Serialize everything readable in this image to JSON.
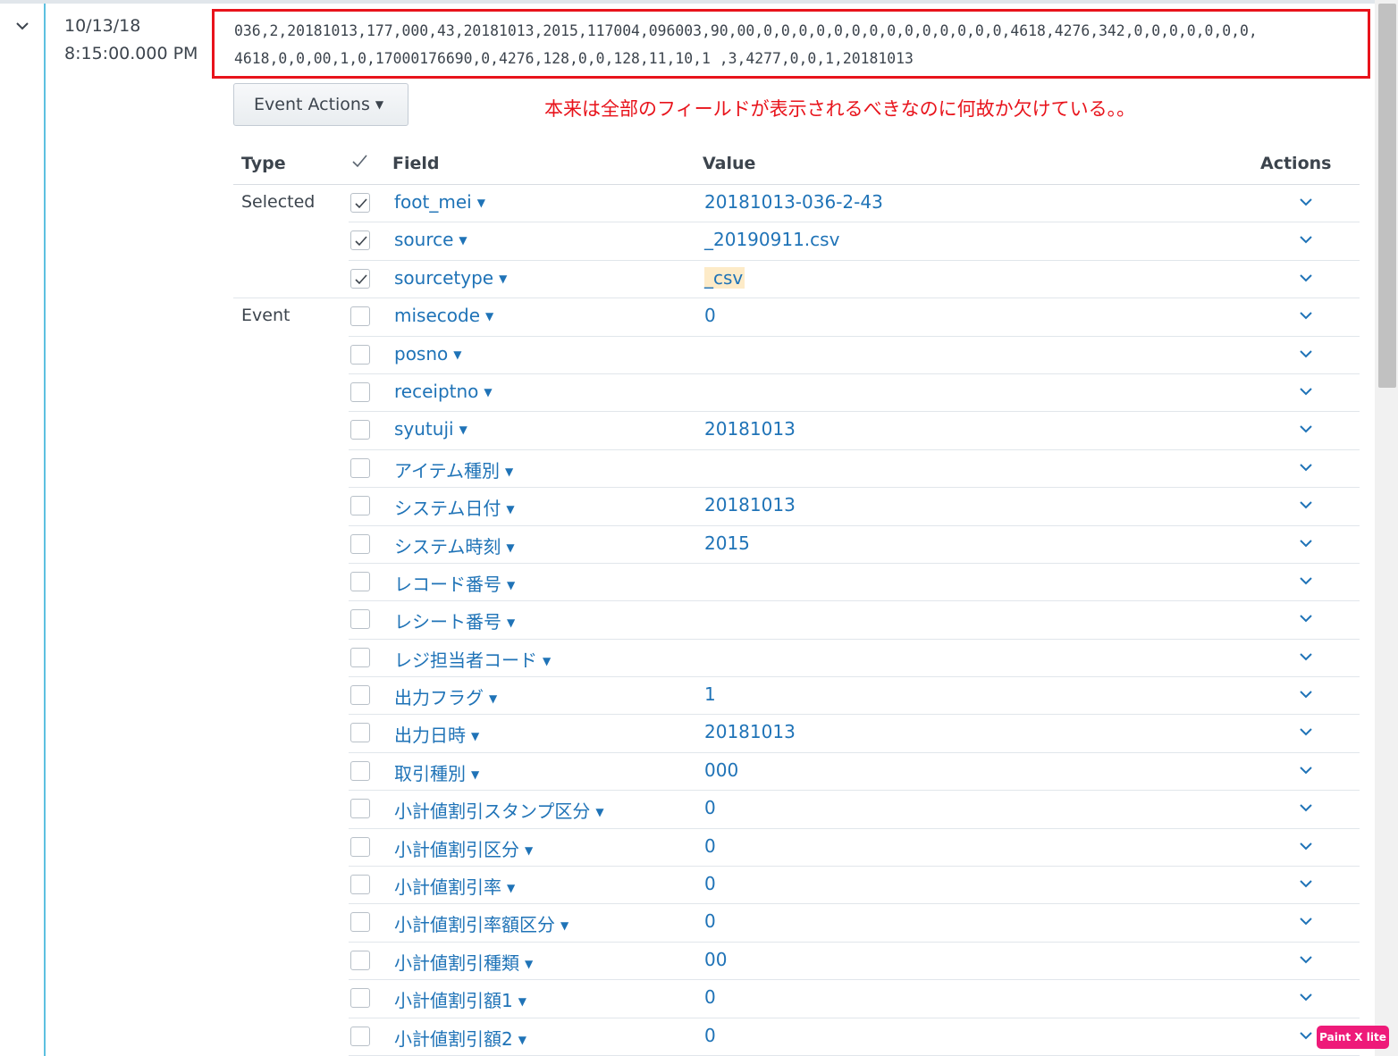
{
  "event": {
    "date": "10/13/18",
    "time": "8:15:00.000 PM",
    "raw_line1": "036,2,20181013,177,000,43,20181013,2015,117004,096003,90,00,0,0,0,0,0,0,0,0,0,0,0,0,0,0,4618,4276,342,0,0,0,0,0,0,0,",
    "raw_line2": "4618,0,0,00,1,0,17000176690,0,4276,128,0,0,128,11,10,1 ,3,4277,0,0,1,20181013"
  },
  "event_actions_label": "Event Actions",
  "annotation": "本来は全部のフィールドが表示されるべきなのに何故か欠けている。。",
  "table": {
    "headers": {
      "type": "Type",
      "field": "Field",
      "value": "Value",
      "actions": "Actions"
    },
    "rows": [
      {
        "type": "Selected",
        "field": "foot_mei",
        "value": "20181013-036-2-43",
        "checked": true
      },
      {
        "type": "",
        "field": "source",
        "value": "_20190911.csv",
        "checked": true
      },
      {
        "type": "",
        "field": "sourcetype",
        "value": "_csv",
        "checked": true
      },
      {
        "type": "Event",
        "field": "misecode",
        "value": "0",
        "checked": false
      },
      {
        "type": "",
        "field": "posno",
        "value": "",
        "checked": false
      },
      {
        "type": "",
        "field": "receiptno",
        "value": "",
        "checked": false
      },
      {
        "type": "",
        "field": "syutuji",
        "value": "20181013",
        "checked": false
      },
      {
        "type": "",
        "field": "アイテム種別",
        "value": "",
        "checked": false
      },
      {
        "type": "",
        "field": "システム日付",
        "value": "20181013",
        "checked": false
      },
      {
        "type": "",
        "field": "システム時刻",
        "value": "2015",
        "checked": false
      },
      {
        "type": "",
        "field": "レコード番号",
        "value": "",
        "checked": false
      },
      {
        "type": "",
        "field": "レシート番号",
        "value": "",
        "checked": false
      },
      {
        "type": "",
        "field": "レジ担当者コード",
        "value": "",
        "checked": false
      },
      {
        "type": "",
        "field": "出力フラグ",
        "value": "1",
        "checked": false
      },
      {
        "type": "",
        "field": "出力日時",
        "value": "20181013",
        "checked": false
      },
      {
        "type": "",
        "field": "取引種別",
        "value": "000",
        "checked": false
      },
      {
        "type": "",
        "field": "小計値割引スタンプ区分",
        "value": "0",
        "checked": false
      },
      {
        "type": "",
        "field": "小計値割引区分",
        "value": "0",
        "checked": false
      },
      {
        "type": "",
        "field": "小計値割引率",
        "value": "0",
        "checked": false
      },
      {
        "type": "",
        "field": "小計値割引率額区分",
        "value": "0",
        "checked": false
      },
      {
        "type": "",
        "field": "小計値割引種類",
        "value": "00",
        "checked": false
      },
      {
        "type": "",
        "field": "小計値割引額1",
        "value": "0",
        "checked": false
      },
      {
        "type": "",
        "field": "小計値割引額2",
        "value": "0",
        "checked": false
      }
    ]
  },
  "watermark": "Paint X lite",
  "colors": {
    "link": "#1f73b7",
    "annotation": "#e8131b",
    "rail": "#5cc0e0"
  },
  "icons": {
    "expand": "chevron-down-icon",
    "action": "chevron-down-icon",
    "checkbox": "check-icon"
  }
}
